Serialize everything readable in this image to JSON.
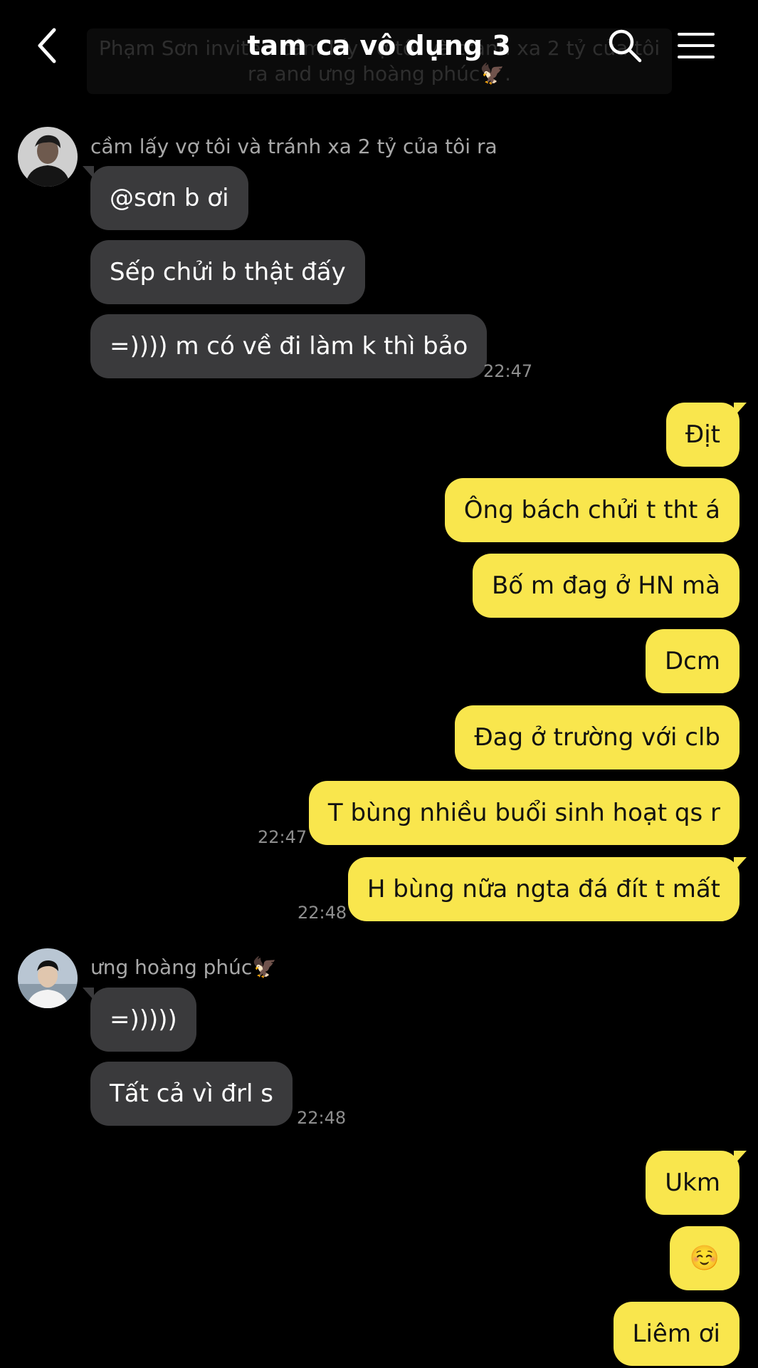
{
  "header": {
    "title": "tam ca vô dụng 3",
    "notice": "Phạm Sơn invited cầm lấy vợ tôi và tránh xa 2 tỷ của tôi ra and ưng hoàng phúc🦅."
  },
  "groups": [
    {
      "sender": "cầm lấy vợ tôi và tránh xa 2 tỷ của tôi ra",
      "messages": [
        "@sơn b ơi",
        "Sếp chửi b thật đấy",
        "=)))) m có về đi làm k thì bảo"
      ],
      "time": "22:47"
    },
    {
      "messages": [
        "Địt",
        "Ông bách chửi t tht á",
        "Bố m đag ở HN mà",
        "Dcm",
        "Đag ở trường với clb",
        "T bùng nhiều buổi sinh hoạt qs r"
      ],
      "time": "22:47"
    },
    {
      "messages": [
        "H bùng nữa ngta đá đít t mất"
      ],
      "time": "22:48"
    },
    {
      "sender": "ưng hoàng phúc🦅",
      "messages": [
        "=)))))",
        "Tất cả vì đrl s"
      ],
      "time": "22:48"
    },
    {
      "messages": [
        "Ukm",
        "☺️",
        "Liêm ơi"
      ]
    }
  ]
}
